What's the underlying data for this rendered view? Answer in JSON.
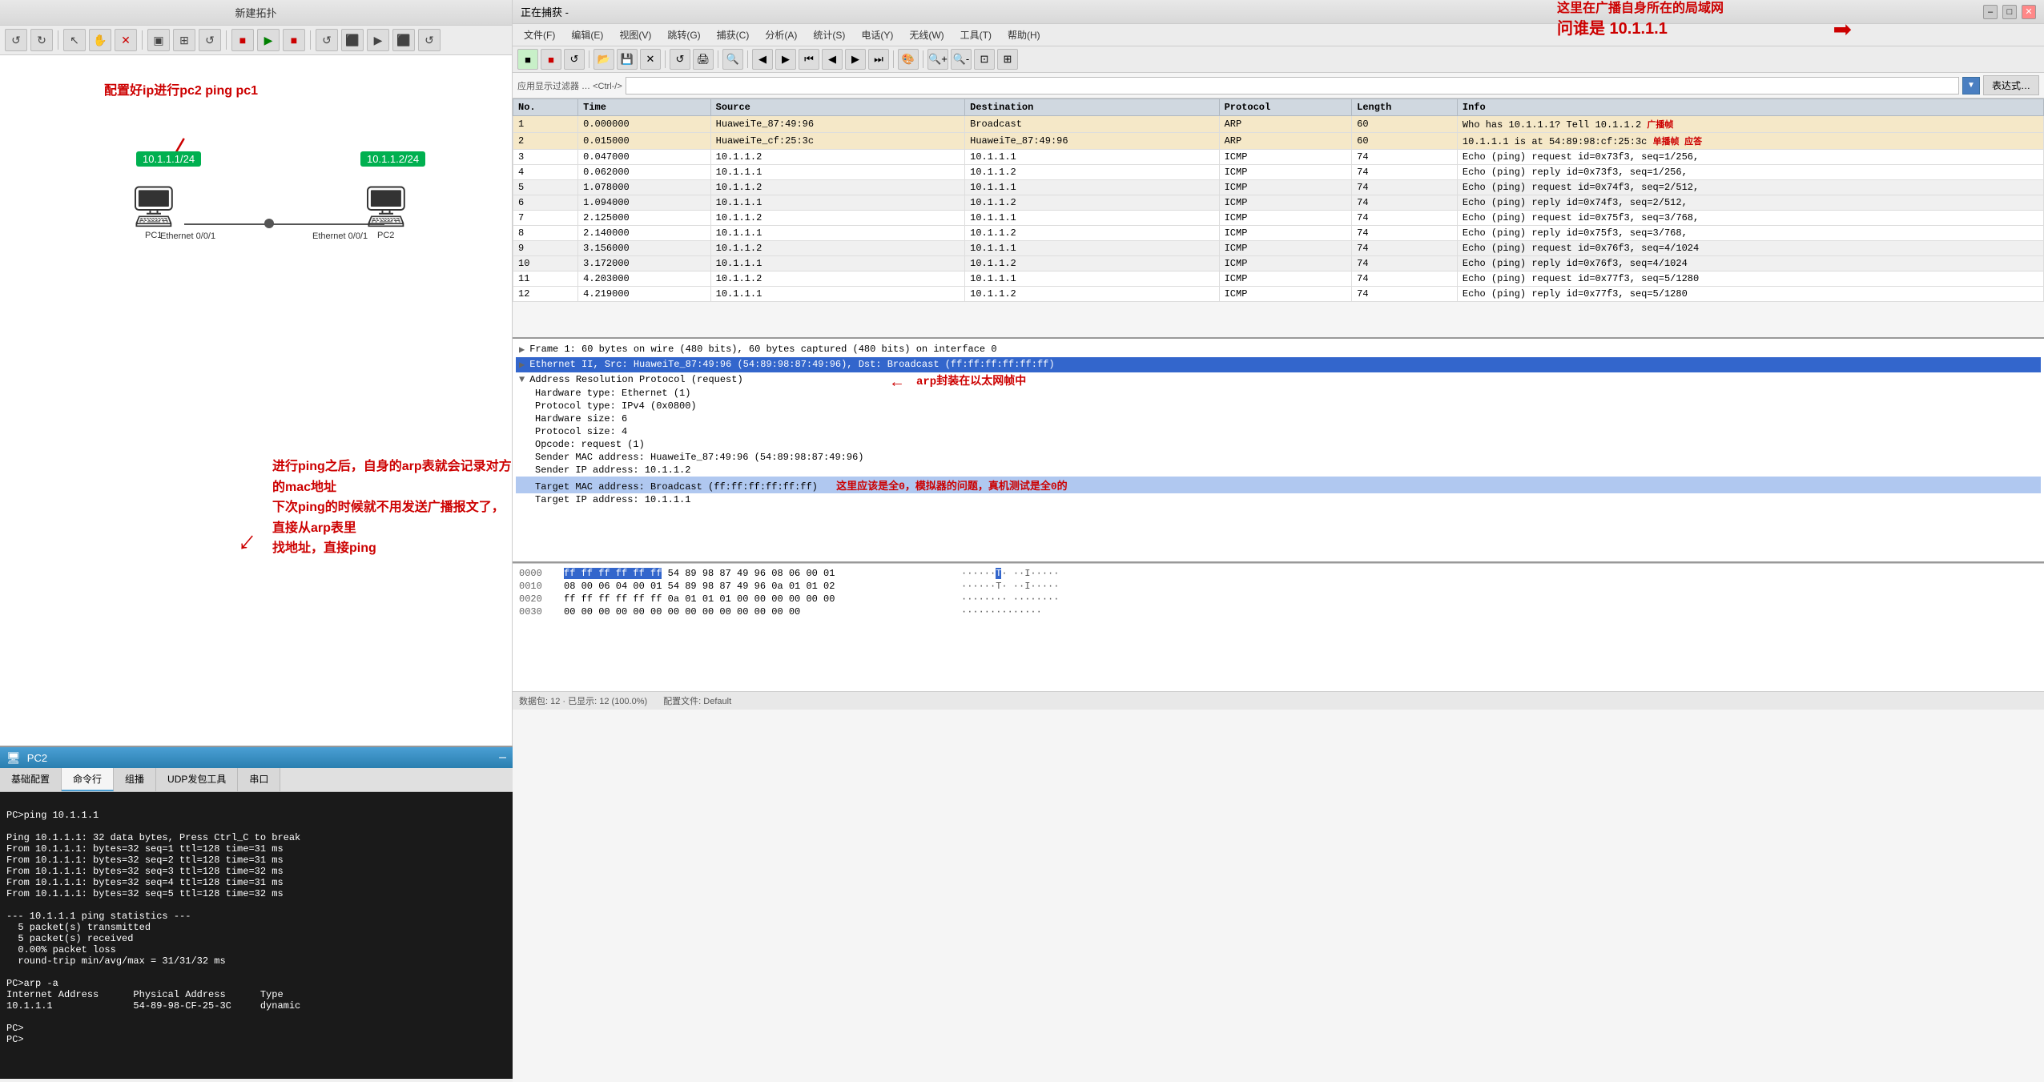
{
  "left_panel": {
    "title": "新建拓扑",
    "toolbar_buttons": [
      "↺",
      "↻",
      "↖",
      "✋",
      "✕",
      "▣",
      "⊞",
      "↺",
      "↺",
      "⬛",
      "▶",
      "⬛",
      "↻",
      "↺",
      "⬛",
      "▶",
      "⬛",
      "↺"
    ],
    "annotation": "配置好ip进行pc2  ping  pc1",
    "ip_label_left": "10.1.1.1/24",
    "ip_label_right": "10.1.1.2/24",
    "device_left": "PC1",
    "device_right": "PC2",
    "port_left": "Ethernet 0/0/1",
    "port_right": "Ethernet 0/0/1"
  },
  "pc2_window": {
    "title": "PC2",
    "tabs": [
      "基础配置",
      "命令行",
      "组播",
      "UDP发包工具",
      "串口"
    ],
    "active_tab": "命令行",
    "terminal_content": "PC>ping 10.1.1.1\n\nPing 10.1.1.1: 32 data bytes, Press Ctrl_C to break\nFrom 10.1.1.1: bytes=32 seq=1 ttl=128 time=31 ms\nFrom 10.1.1.1: bytes=32 seq=2 ttl=128 time=31 ms\nFrom 10.1.1.1: bytes=32 seq=3 ttl=128 time=32 ms\nFrom 10.1.1.1: bytes=32 seq=4 ttl=128 time=31 ms\nFrom 10.1.1.1: bytes=32 seq=5 ttl=128 time=32 ms\n\n--- 10.1.1.1 ping statistics ---\n  5 packet(s) transmitted\n  5 packet(s) received\n  0.00% packet loss\n  round-trip min/avg/max = 31/31/32 ms\n\nPC>arp -a\nInternet Address      Physical Address      Type\n10.1.1.1              54-89-98-CF-25-3C     dynamic\n\nPC>\nPC>"
  },
  "annotation_ping": "进行ping之后，自身的arp表就会记录对方的mac地址\n下次ping的时候就不用发送广播报文了，直接从arp表里\n找地址，直接ping",
  "wireshark": {
    "title": "正在捕获 -",
    "menu_items": [
      "文件(F)",
      "编辑(E)",
      "视图(V)",
      "跳转(G)",
      "捕获(C)",
      "分析(A)",
      "统计(S)",
      "电话(Y)",
      "无线(W)",
      "工具(T)",
      "帮助(H)"
    ],
    "filter_placeholder": "应用显示过滤器 … <Ctrl-/>",
    "filter_value": "",
    "filter_btn": "表达式…",
    "annotation_broadcast": "这里在广播自身所在的局域网\n问谁是 10.1.1.1",
    "columns": [
      "No.",
      "Time",
      "Source",
      "Destination",
      "Protocol",
      "Length",
      "Info"
    ],
    "packets": [
      {
        "no": "1",
        "time": "0.000000",
        "source": "HuaweiTe_87:49:96",
        "destination": "Broadcast",
        "protocol": "ARP",
        "length": "60",
        "info": "Who has 10.1.1.1? Tell 10.1.1.2",
        "note": "广播帧",
        "row_class": "arp"
      },
      {
        "no": "2",
        "time": "0.015000",
        "source": "HuaweiTe_cf:25:3c",
        "destination": "HuaweiTe_87:49:96",
        "protocol": "ARP",
        "length": "60",
        "info": "10.1.1.1 is at 54:89:98:cf:25:3c",
        "note": "单播帧 应答",
        "row_class": "arp"
      },
      {
        "no": "3",
        "time": "0.047000",
        "source": "10.1.1.2",
        "destination": "10.1.1.1",
        "protocol": "ICMP",
        "length": "74",
        "info": "Echo (ping) request  id=0x73f3, seq=1/256,",
        "note": "",
        "row_class": "normal"
      },
      {
        "no": "4",
        "time": "0.062000",
        "source": "10.1.1.1",
        "destination": "10.1.1.2",
        "protocol": "ICMP",
        "length": "74",
        "info": "Echo (ping) reply    id=0x73f3, seq=1/256,",
        "note": "",
        "row_class": "normal"
      },
      {
        "no": "5",
        "time": "1.078000",
        "source": "10.1.1.2",
        "destination": "10.1.1.1",
        "protocol": "ICMP",
        "length": "74",
        "info": "Echo (ping) request  id=0x74f3, seq=2/512,",
        "note": "",
        "row_class": "alt"
      },
      {
        "no": "6",
        "time": "1.094000",
        "source": "10.1.1.1",
        "destination": "10.1.1.2",
        "protocol": "ICMP",
        "length": "74",
        "info": "Echo (ping) reply    id=0x74f3, seq=2/512,",
        "note": "",
        "row_class": "alt"
      },
      {
        "no": "7",
        "time": "2.125000",
        "source": "10.1.1.2",
        "destination": "10.1.1.1",
        "protocol": "ICMP",
        "length": "74",
        "info": "Echo (ping) request  id=0x75f3, seq=3/768,",
        "note": "",
        "row_class": "normal"
      },
      {
        "no": "8",
        "time": "2.140000",
        "source": "10.1.1.1",
        "destination": "10.1.1.2",
        "protocol": "ICMP",
        "length": "74",
        "info": "Echo (ping) reply    id=0x75f3, seq=3/768,",
        "note": "",
        "row_class": "normal"
      },
      {
        "no": "9",
        "time": "3.156000",
        "source": "10.1.1.2",
        "destination": "10.1.1.1",
        "protocol": "ICMP",
        "length": "74",
        "info": "Echo (ping) request  id=0x76f3, seq=4/1024",
        "note": "",
        "row_class": "alt"
      },
      {
        "no": "10",
        "time": "3.172000",
        "source": "10.1.1.1",
        "destination": "10.1.1.2",
        "protocol": "ICMP",
        "length": "74",
        "info": "Echo (ping) reply    id=0x76f3, seq=4/1024",
        "note": "",
        "row_class": "alt"
      },
      {
        "no": "11",
        "time": "4.203000",
        "source": "10.1.1.2",
        "destination": "10.1.1.1",
        "protocol": "ICMP",
        "length": "74",
        "info": "Echo (ping) request  id=0x77f3, seq=5/1280",
        "note": "",
        "row_class": "normal"
      },
      {
        "no": "12",
        "time": "4.219000",
        "source": "10.1.1.1",
        "destination": "10.1.1.2",
        "protocol": "ICMP",
        "length": "74",
        "info": "Echo (ping) reply    id=0x77f3, seq=5/1280",
        "note": "",
        "row_class": "normal"
      }
    ],
    "detail_sections": [
      {
        "label": "Frame 1: 60 bytes on wire (480 bits), 60 bytes captured (480 bits) on interface 0",
        "expanded": false,
        "selected": false
      },
      {
        "label": "Ethernet II, Src: HuaweiTe_87:49:96 (54:89:98:87:49:96), Dst: Broadcast (ff:ff:ff:ff:ff:ff)",
        "expanded": false,
        "selected": true
      },
      {
        "label": "Address Resolution Protocol (request)",
        "expanded": true,
        "selected": false
      }
    ],
    "arp_details": [
      "Hardware type: Ethernet (1)",
      "Protocol type: IPv4 (0x0800)",
      "Hardware size: 6",
      "Protocol size: 4",
      "Opcode: request (1)",
      "Sender MAC address: HuaweiTe_87:49:96 (54:89:98:87:49:96)",
      "Sender IP address: 10.1.1.2",
      "Target MAC address: Broadcast (ff:ff:ff:ff:ff:ff)",
      "Target IP address: 10.1.1.1"
    ],
    "target_mac_annotation": "这里应该是全0，模拟器的问题，真机测试是全0的",
    "arp_encap_annotation": "arp封装在以太网帧中",
    "hex_rows": [
      {
        "offset": "0000",
        "bytes": "ff ff ff ff ff ff 54 89  98 87 49 96 08 06 00 01",
        "ascii": "······T·  ··I·····"
      },
      {
        "offset": "0010",
        "bytes": "08 00 06 04 00 01 54 89  98 87 49 96 0a 01 01 02",
        "ascii": "······T·  ··I·····"
      },
      {
        "offset": "0020",
        "bytes": "ff ff ff ff ff ff 0a 01  01 01 00 00 00 00 00 00",
        "ascii": "········  ········"
      },
      {
        "offset": "0030",
        "bytes": "00 00 00 00 00 00 00 00  00 00 00 00 00 00",
        "ascii": "··············"
      }
    ]
  }
}
